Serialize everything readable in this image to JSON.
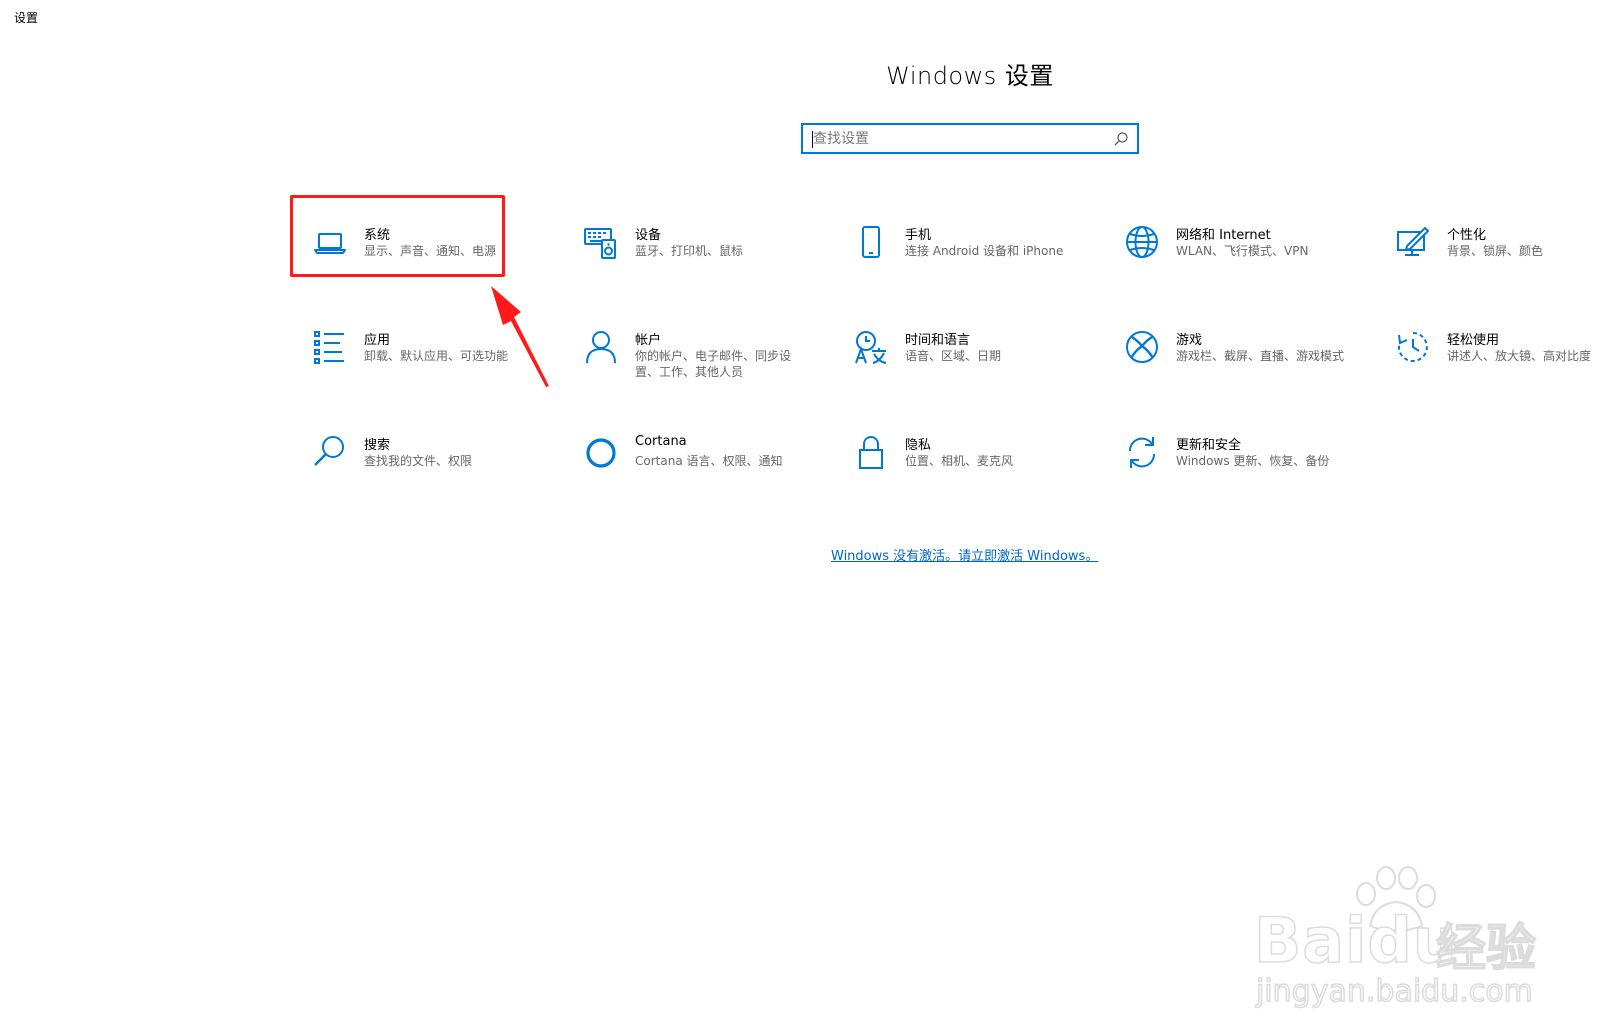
{
  "window": {
    "title": "设置"
  },
  "page": {
    "title": "Windows 设置"
  },
  "search": {
    "placeholder": "查找设置",
    "icon": "search-icon"
  },
  "accent_color": "#0078d7",
  "tiles": [
    {
      "id": "system",
      "name": "系统",
      "desc": "显示、声音、通知、电源",
      "icon": "laptop-icon"
    },
    {
      "id": "devices",
      "name": "设备",
      "desc": "蓝牙、打印机、鼠标",
      "icon": "keyboard-speaker-icon"
    },
    {
      "id": "phone",
      "name": "手机",
      "desc": "连接 Android 设备和 iPhone",
      "icon": "phone-icon"
    },
    {
      "id": "network",
      "name": "网络和 Internet",
      "desc": "WLAN、飞行模式、VPN",
      "icon": "globe-icon"
    },
    {
      "id": "personalization",
      "name": "个性化",
      "desc": "背景、锁屏、颜色",
      "icon": "paint-monitor-icon"
    },
    {
      "id": "apps",
      "name": "应用",
      "desc": "卸载、默认应用、可选功能",
      "icon": "app-list-icon"
    },
    {
      "id": "accounts",
      "name": "帐户",
      "desc": "你的帐户、电子邮件、同步设置、工作、其他人员",
      "icon": "person-icon"
    },
    {
      "id": "time-language",
      "name": "时间和语言",
      "desc": "语音、区域、日期",
      "icon": "time-language-icon"
    },
    {
      "id": "gaming",
      "name": "游戏",
      "desc": "游戏栏、截屏、直播、游戏模式",
      "icon": "xbox-icon"
    },
    {
      "id": "ease-of-access",
      "name": "轻松使用",
      "desc": "讲述人、放大镜、高对比度",
      "icon": "ease-of-access-icon"
    },
    {
      "id": "search",
      "name": "搜索",
      "desc": "查找我的文件、权限",
      "icon": "magnifier-icon"
    },
    {
      "id": "cortana",
      "name": "Cortana",
      "desc": "Cortana 语言、权限、通知",
      "icon": "cortana-icon"
    },
    {
      "id": "privacy",
      "name": "隐私",
      "desc": "位置、相机、麦克风",
      "icon": "lock-icon"
    },
    {
      "id": "update-security",
      "name": "更新和安全",
      "desc": "Windows 更新、恢复、备份",
      "icon": "sync-icon"
    }
  ],
  "activation": {
    "link": "Windows 没有激活。请立即激活 Windows。"
  },
  "annotation": {
    "color": "#ff1a1a",
    "target": "system"
  },
  "watermark": {
    "brand": "Bai",
    "brand2": "du",
    "cn": "经验",
    "domain": "jingyan.baidu.com"
  }
}
